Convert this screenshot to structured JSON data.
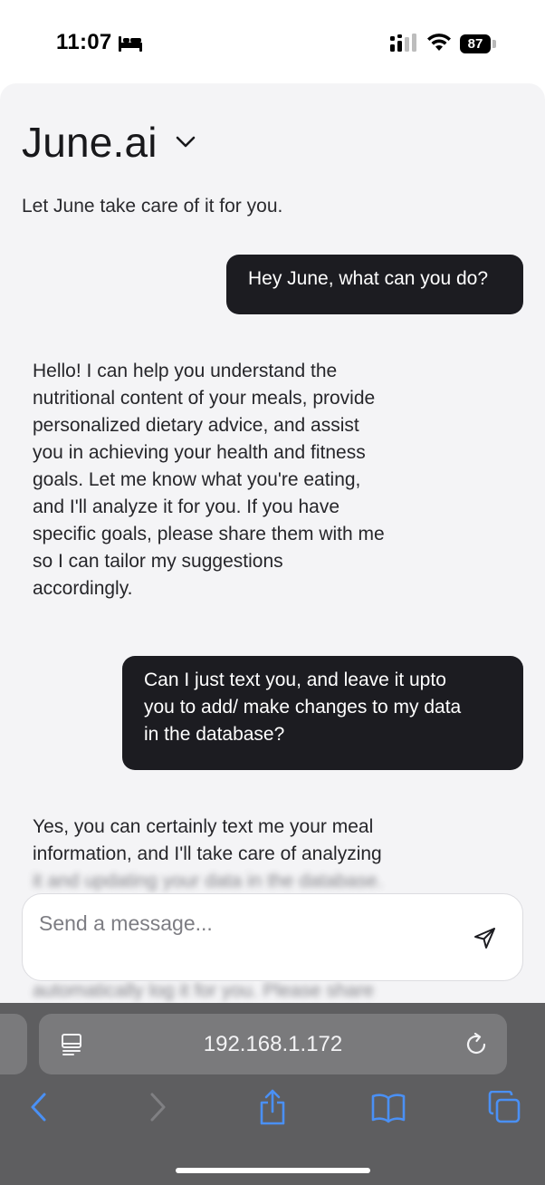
{
  "status_bar": {
    "time": "11:07",
    "battery": "87",
    "icons": [
      "bed-icon",
      "cellular-signal-icon",
      "wifi-icon",
      "battery-icon"
    ]
  },
  "app": {
    "title": "June.ai",
    "tagline": "Let June take care of it for you."
  },
  "messages": [
    {
      "role": "user",
      "text": "Hey June, what can you do?"
    },
    {
      "role": "assistant",
      "lines": [
        "Hello! I can help you understand the",
        "nutritional content of your meals, provide",
        "personalized dietary advice, and assist",
        "you in achieving your health and fitness",
        "goals. Let me know what you're eating,",
        "and I'll analyze it for you. If you have",
        "specific goals, please share them with me",
        "so I can tailor my suggestions",
        "accordingly."
      ]
    },
    {
      "role": "user",
      "lines": [
        "Can I just text you, and leave it upto",
        "you to add/ make changes to my data",
        "in the database?"
      ]
    },
    {
      "role": "assistant",
      "lines": [
        "Yes, you can certainly text me your meal",
        "information, and I'll take care of analyzing",
        "it and updating your data in the database.",
        "automatically log it for you. Please share"
      ]
    }
  ],
  "composer": {
    "placeholder": "Send a message...",
    "send_icon": "send-icon"
  },
  "browser": {
    "url": "192.168.1.172",
    "toolbar": [
      "back-icon",
      "forward-icon",
      "share-icon",
      "bookmarks-icon",
      "tabs-icon"
    ],
    "accent": "#4a90f5"
  }
}
